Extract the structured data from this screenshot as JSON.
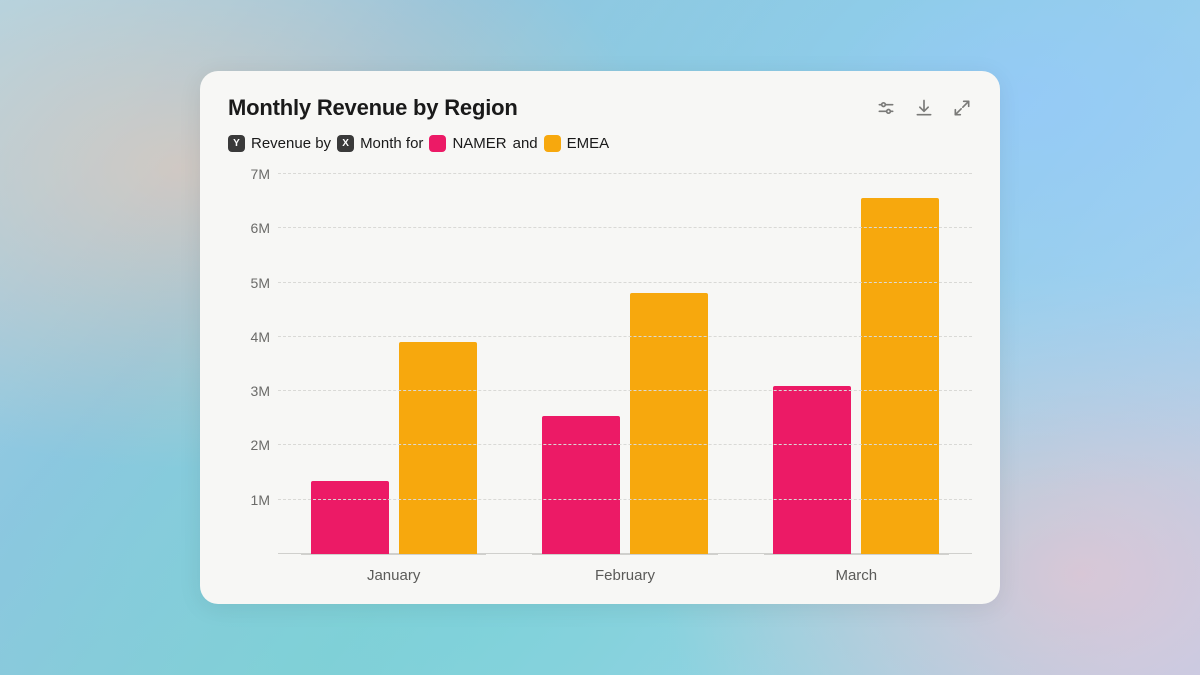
{
  "title": "Monthly Revenue by Region",
  "legend": {
    "y_badge": "Y",
    "y_text": "Revenue by",
    "x_badge": "X",
    "x_text": "Month for",
    "series1": "NAMER",
    "and": "and",
    "series2": "EMEA"
  },
  "y_ticks": [
    "1M",
    "2M",
    "3M",
    "4M",
    "5M",
    "6M",
    "7M"
  ],
  "x_ticks": [
    "January",
    "February",
    "March"
  ],
  "colors": {
    "namer": "#ec1a66",
    "emea": "#f7a80d"
  },
  "chart_data": {
    "type": "bar",
    "title": "Monthly Revenue by Region",
    "xlabel": "Month",
    "ylabel": "Revenue",
    "ylim": [
      0,
      7000000
    ],
    "categories": [
      "January",
      "February",
      "March"
    ],
    "series": [
      {
        "name": "NAMER",
        "values": [
          1350000,
          2550000,
          3100000
        ]
      },
      {
        "name": "EMEA",
        "values": [
          3900000,
          4800000,
          6550000
        ]
      }
    ]
  }
}
